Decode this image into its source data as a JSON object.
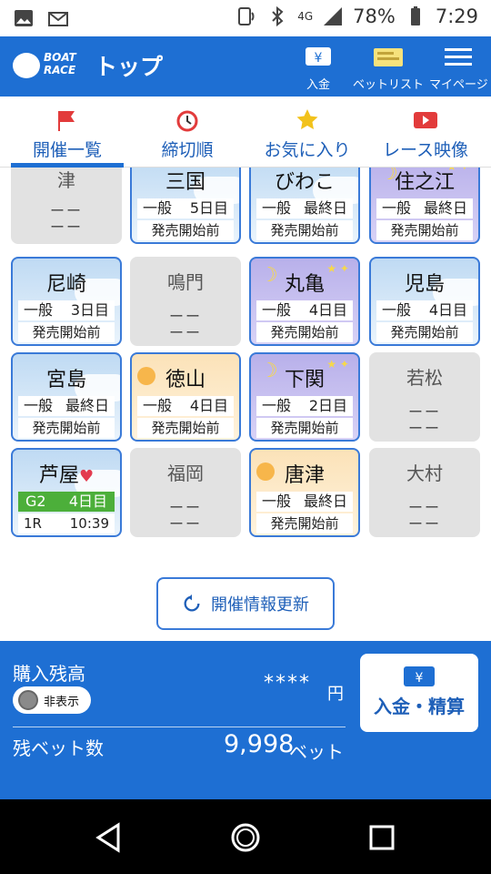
{
  "status_bar": {
    "network": "4G",
    "battery": "78%",
    "time": "7:29"
  },
  "app_bar": {
    "logo_text": "BOAT RACE",
    "title": "トップ",
    "buttons": [
      {
        "label": "入金",
        "icon": "yen-deposit-icon"
      },
      {
        "label": "ベットリスト",
        "icon": "ticket-icon"
      },
      {
        "label": "マイページ",
        "icon": "menu-icon"
      }
    ]
  },
  "tabs": [
    {
      "label": "開催一覧",
      "icon": "flag-icon",
      "active": true
    },
    {
      "label": "締切順",
      "icon": "alarm-clock-icon",
      "active": false
    },
    {
      "label": "お気に入り",
      "icon": "star-icon",
      "active": false
    },
    {
      "label": "レース映像",
      "icon": "video-play-icon",
      "active": false
    }
  ],
  "venues": [
    {
      "name": "津",
      "state": "off",
      "line1": "ーー",
      "line2": "ーー"
    },
    {
      "name": "三国",
      "state": "on",
      "theme": "day",
      "grade": "一般",
      "day": "5日目",
      "status": "発売開始前"
    },
    {
      "name": "びわこ",
      "state": "on",
      "theme": "day",
      "grade": "一般",
      "day": "最終日",
      "status": "発売開始前"
    },
    {
      "name": "住之江",
      "state": "on",
      "theme": "night",
      "grade": "一般",
      "day": "最終日",
      "status": "発売開始前"
    },
    {
      "name": "尼崎",
      "state": "on",
      "theme": "day",
      "grade": "一般",
      "day": "3日目",
      "status": "発売開始前"
    },
    {
      "name": "鳴門",
      "state": "off",
      "line1": "ーー",
      "line2": "ーー"
    },
    {
      "name": "丸亀",
      "state": "on",
      "theme": "night",
      "grade": "一般",
      "day": "4日目",
      "status": "発売開始前"
    },
    {
      "name": "児島",
      "state": "on",
      "theme": "day",
      "grade": "一般",
      "day": "4日目",
      "status": "発売開始前"
    },
    {
      "name": "宮島",
      "state": "on",
      "theme": "day",
      "grade": "一般",
      "day": "最終日",
      "status": "発売開始前"
    },
    {
      "name": "徳山",
      "state": "on",
      "theme": "morning",
      "grade": "一般",
      "day": "4日目",
      "status": "発売開始前"
    },
    {
      "name": "下関",
      "state": "on",
      "theme": "night",
      "grade": "一般",
      "day": "2日目",
      "status": "発売開始前"
    },
    {
      "name": "若松",
      "state": "off",
      "line1": "ーー",
      "line2": "ーー"
    },
    {
      "name": "芦屋",
      "state": "live",
      "theme": "day",
      "grade": "G2",
      "day": "4日目",
      "race": "1R",
      "time": "10:39",
      "favorite": true
    },
    {
      "name": "福岡",
      "state": "off",
      "line1": "ーー",
      "line2": "ーー"
    },
    {
      "name": "唐津",
      "state": "on",
      "theme": "morning",
      "grade": "一般",
      "day": "最終日",
      "status": "発売開始前"
    },
    {
      "name": "大村",
      "state": "off",
      "line1": "ーー",
      "line2": "ーー"
    }
  ],
  "refresh_button": {
    "label": "開催情報更新"
  },
  "account": {
    "balance_label": "購入残高",
    "toggle_label": "非表示",
    "balance_value": "****",
    "balance_unit": "円",
    "bets_label": "残ベット数",
    "bets_value": "9,998",
    "bets_unit": "ベット",
    "deposit_label": "入金・精算"
  },
  "colors": {
    "brand": "#1e6fd3",
    "active_border": "#3a7ad8",
    "grade_g2": "#4caf3a",
    "favorite": "#e33b4f"
  }
}
